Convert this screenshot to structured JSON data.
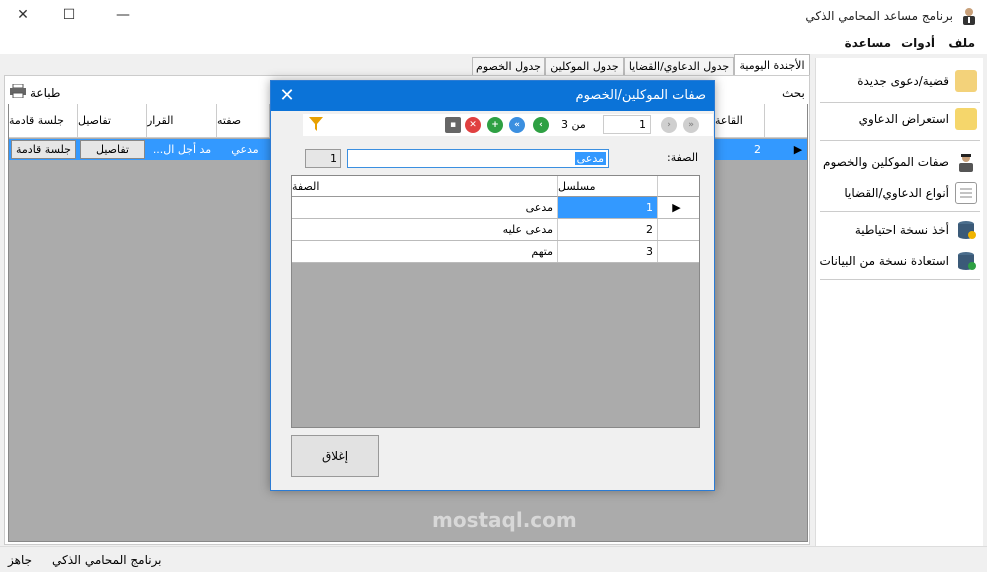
{
  "window": {
    "title": "برنامج مساعد المحامي الذكي",
    "minimize": "—",
    "maximize": "☐",
    "close": "✕"
  },
  "menu": {
    "items": [
      "ملف",
      "أدوات",
      "مساعدة"
    ]
  },
  "sidebar": {
    "items": [
      {
        "label": "قضية/دعوى جديدة",
        "icon": "new-case-icon"
      },
      {
        "label": "استعراض الدعاوي",
        "icon": "folder-icon"
      },
      {
        "label": "صفات الموكلين والخصوم",
        "icon": "person-icon"
      },
      {
        "label": "أنواع الدعاوي/القضايا",
        "icon": "document-icon"
      },
      {
        "label": "أخذ نسخة احتياطية",
        "icon": "database-backup-icon"
      },
      {
        "label": "استعادة نسخة من البيانات",
        "icon": "database-restore-icon"
      }
    ]
  },
  "tabs": [
    "الأجندة اليومية",
    "جدول الدعاوي/القضايا",
    "جدول الموكلين",
    "جدول الخصوم"
  ],
  "main": {
    "search_label": "بحث",
    "print_label": "طباعة",
    "columns": [
      "القاعة",
      "صفته",
      "القرار",
      "تفاصيل",
      "جلسة قادمة"
    ],
    "row": {
      "index": "2",
      "role": "مدعي",
      "decision": "مد أجل ال...",
      "details_btn": "تفاصيل",
      "next_session_btn": "جلسة قادمة"
    }
  },
  "dialog": {
    "title": "صفات الموكلين/الخصوم",
    "navigator": {
      "position": "1",
      "of_label": "من 3"
    },
    "field_label": "الصفة:",
    "field_value": "مدعى",
    "id_value": "1",
    "columns": [
      "مسلسل",
      "الصفة"
    ],
    "rows": [
      {
        "serial": "1",
        "name": "مدعى"
      },
      {
        "serial": "2",
        "name": "مدعى عليه"
      },
      {
        "serial": "3",
        "name": "متهم"
      }
    ],
    "close_button": "إغلاق"
  },
  "status": {
    "text": "جاهز",
    "app_name": "برنامج المحامي الذكي"
  },
  "watermark": "mostaql.com",
  "colors": {
    "accent": "#0b73d8",
    "selection": "#3399ff",
    "grid_bg": "#ababab"
  }
}
